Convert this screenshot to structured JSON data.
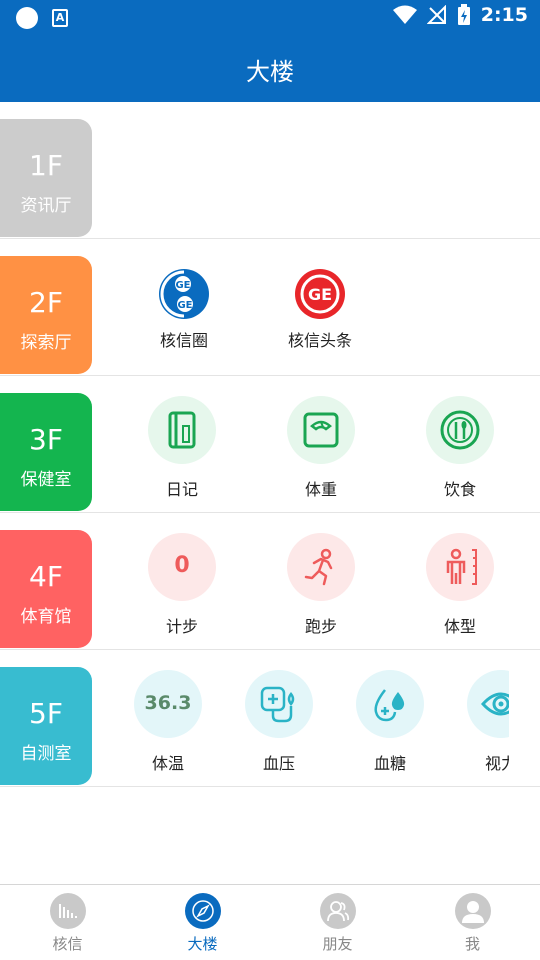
{
  "status": {
    "time": "2:15"
  },
  "header": {
    "title": "大楼"
  },
  "floors": [
    {
      "num": "1F",
      "name": "资讯厅",
      "color": "#cccccc",
      "items": []
    },
    {
      "num": "2F",
      "name": "探索厅",
      "color": "#ff9144",
      "items": [
        {
          "label": "核信圈",
          "icon": "hexin-circle-logo"
        },
        {
          "label": "核信头条",
          "icon": "hexin-headline-logo"
        }
      ]
    },
    {
      "num": "3F",
      "name": "保健室",
      "color": "#14b54f",
      "items": [
        {
          "label": "日记",
          "icon": "diary-icon"
        },
        {
          "label": "体重",
          "icon": "scale-icon"
        },
        {
          "label": "饮食",
          "icon": "dining-icon"
        }
      ]
    },
    {
      "num": "4F",
      "name": "体育馆",
      "color": "#ff6262",
      "items": [
        {
          "label": "计步",
          "value": "0"
        },
        {
          "label": "跑步",
          "icon": "running-icon"
        },
        {
          "label": "体型",
          "icon": "body-shape-icon"
        }
      ]
    },
    {
      "num": "5F",
      "name": "自测室",
      "color": "#38bcd0",
      "items": [
        {
          "label": "体温",
          "value": "36.3"
        },
        {
          "label": "血压",
          "icon": "blood-pressure-icon"
        },
        {
          "label": "血糖",
          "icon": "blood-sugar-icon"
        },
        {
          "label": "视力",
          "icon": "eye-icon"
        }
      ]
    }
  ],
  "nav": [
    {
      "label": "核信",
      "icon": "hexin-tab-icon"
    },
    {
      "label": "大楼",
      "icon": "compass-icon",
      "active": true
    },
    {
      "label": "朋友",
      "icon": "friends-icon"
    },
    {
      "label": "我",
      "icon": "profile-icon"
    }
  ],
  "colors": {
    "primary": "#0a6bbf",
    "green": "#14b54f",
    "red": "#ff6262",
    "cyan": "#38bcd0"
  }
}
